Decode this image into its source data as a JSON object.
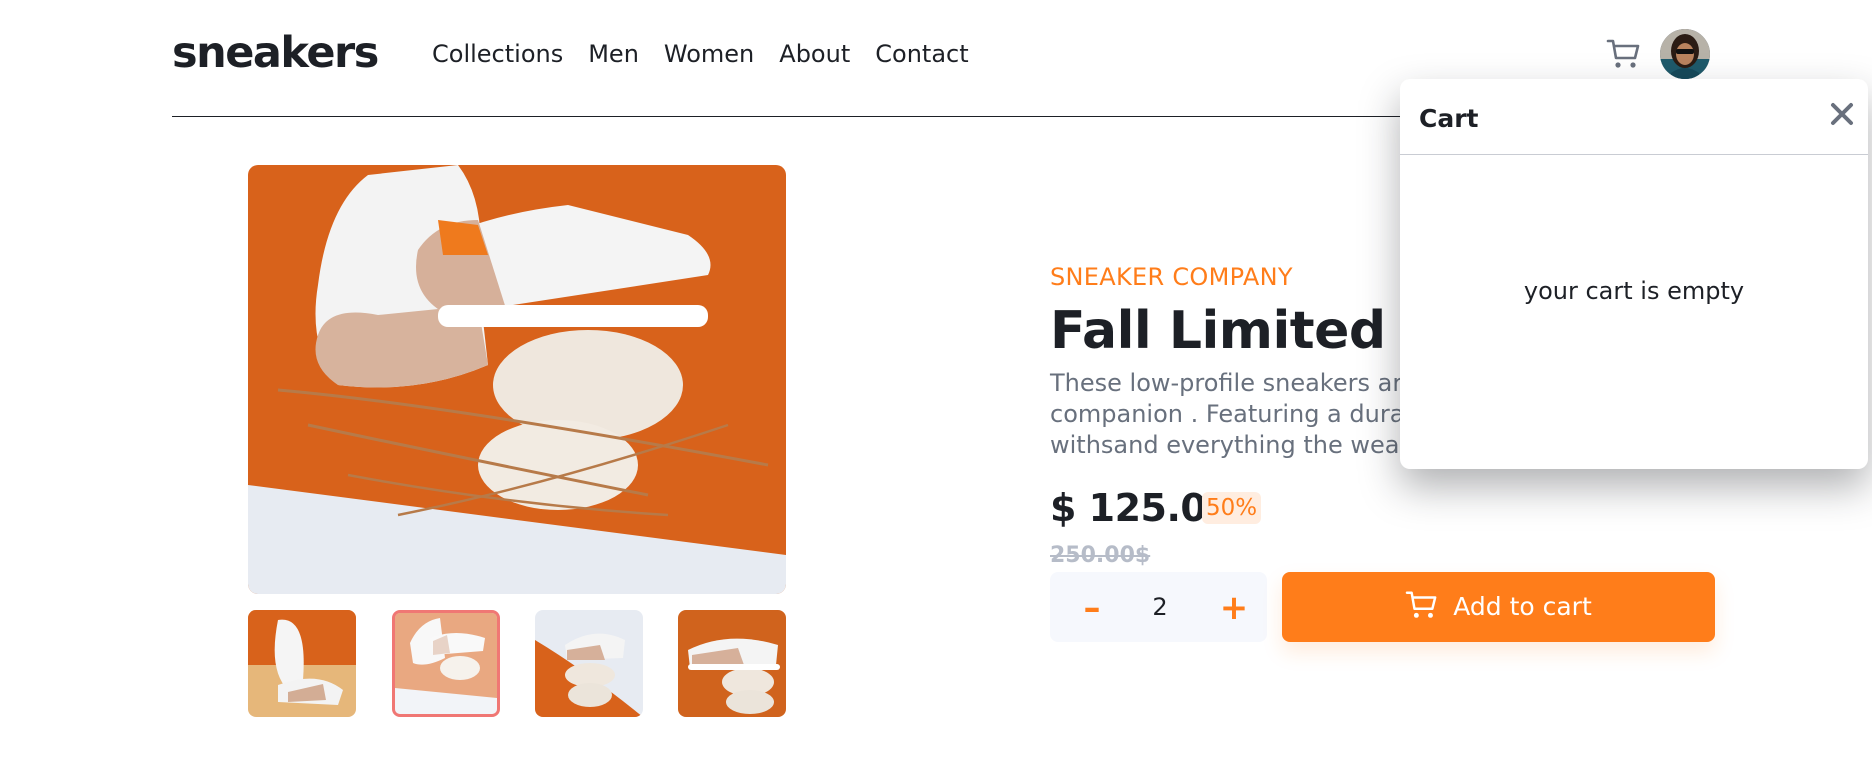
{
  "header": {
    "logo": "sneakers",
    "nav": [
      "Collections",
      "Men",
      "Women",
      "About",
      "Contact"
    ],
    "cart_icon": "cart-icon",
    "avatar_icon": "avatar"
  },
  "gallery": {
    "main_image": "product-photo-1",
    "thumbnails": [
      "product-thumb-1",
      "product-thumb-2",
      "product-thumb-3",
      "product-thumb-4"
    ],
    "active_thumbnail_index": 1
  },
  "product": {
    "company": "SNEAKER COMPANY",
    "title": "Fall Limited Edi",
    "description_lines": [
      "These low-profile sneakers are",
      "companion . Featuring a durab",
      "withsand everything the weath"
    ],
    "price": "$ 125.00",
    "discount": "50%",
    "old_price": "250.00$"
  },
  "quantity": {
    "minus": "–",
    "value": "2",
    "plus": "+"
  },
  "add_to_cart": {
    "label": "Add to cart"
  },
  "cart": {
    "title": "Cart",
    "empty_message": "your cart is empty",
    "close_icon": "close-icon"
  },
  "colors": {
    "accent": "#ff7d1a",
    "accent_pale": "#ffede0",
    "text_dark": "#1d2026",
    "text_gray": "#68707d",
    "muted": "#b6bcc8",
    "qty_bg": "#f6f8fd",
    "active_thumb_border": "#f07774"
  }
}
